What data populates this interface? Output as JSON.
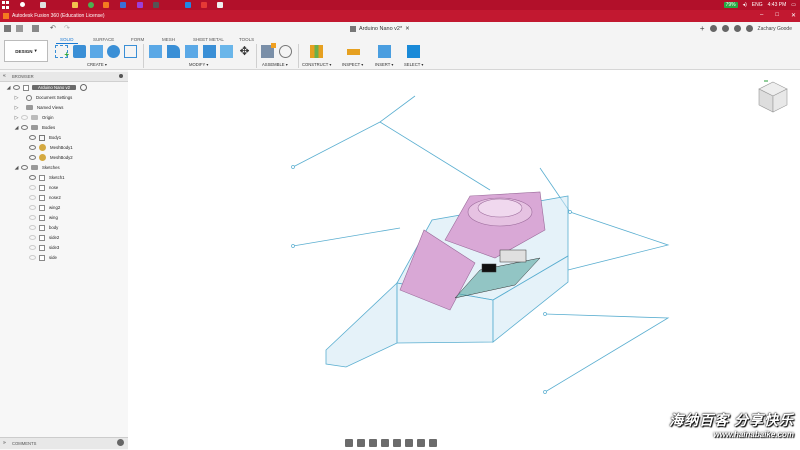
{
  "taskbar": {
    "battery": "79%",
    "language": "ENG",
    "time": "4:43 PM"
  },
  "window": {
    "title": "Autodesk Fusion 360 (Education License)"
  },
  "document": {
    "tab_title": "Arduino Nano v2*",
    "user": "Zachary Goode"
  },
  "toolbar": {
    "workspace": "DESIGN",
    "tabs": [
      "SOLID",
      "SURFACE",
      "FORM",
      "MESH",
      "SHEET METAL",
      "TOOLS"
    ],
    "groups": [
      "CREATE",
      "MODIFY",
      "ASSEMBLE",
      "CONSTRUCT",
      "INSPECT",
      "INSERT",
      "SELECT"
    ]
  },
  "browser": {
    "title": "BROWSER",
    "root": "Arduino Nano v2",
    "items": [
      "Document Settings",
      "Named Views",
      "Origin",
      "Bodies",
      "Body1",
      "MeshBody1",
      "MeshBody2",
      "Sketches",
      "Sketch1",
      "nose",
      "nose2",
      "wing2",
      "wing",
      "body",
      "side2",
      "side3",
      "side"
    ]
  },
  "comments": {
    "label": "COMMENTS"
  },
  "watermark": {
    "line1": "海纳百客 分享快乐",
    "line2": "www.hainabaike.com"
  },
  "colors": {
    "accent": "#1a7ad4",
    "titlebar": "#c21830",
    "model_lines": "#5aaed0",
    "mesh": "#d9a8d6"
  }
}
